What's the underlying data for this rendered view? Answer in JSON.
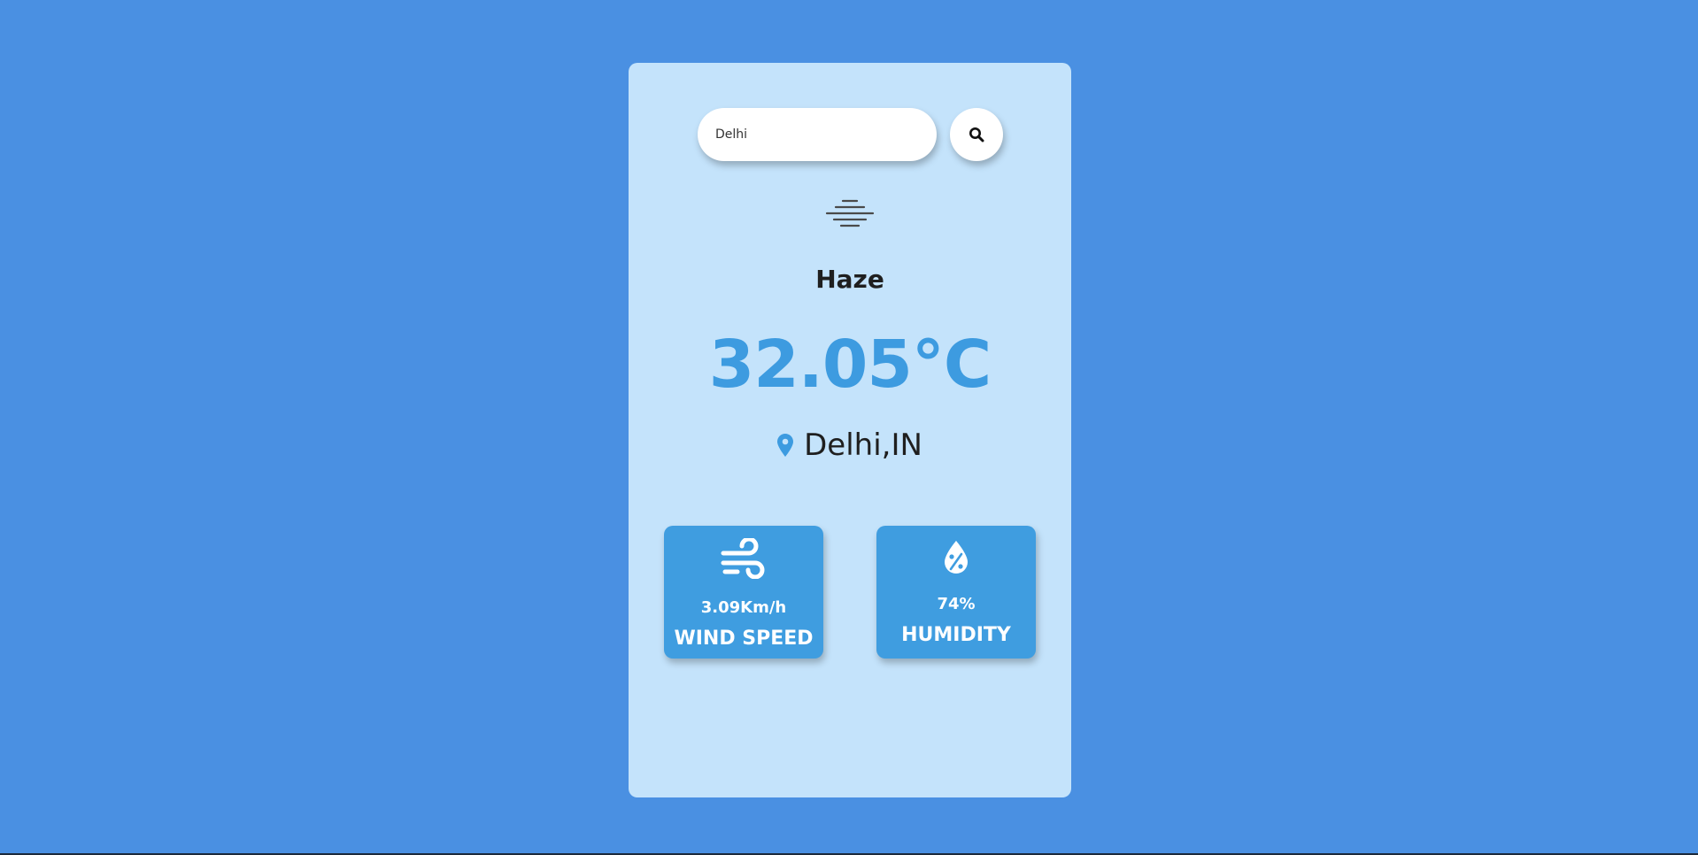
{
  "search": {
    "value": "Delhi",
    "placeholder": ""
  },
  "weather": {
    "icon": "haze-icon",
    "condition": "Haze",
    "temperature": "32.05°C",
    "location": "Delhi,IN"
  },
  "stats": {
    "wind": {
      "icon": "wind-icon",
      "value": "3.09Km/h",
      "label": "WIND SPEED"
    },
    "humidity": {
      "icon": "humidity-icon",
      "value": "74%",
      "label": "HUMIDITY"
    }
  },
  "colors": {
    "page_background": "#4a90e2",
    "card_background": "#c4e3fb",
    "accent": "#3d9be0",
    "stat_box": "#3f9de0"
  }
}
